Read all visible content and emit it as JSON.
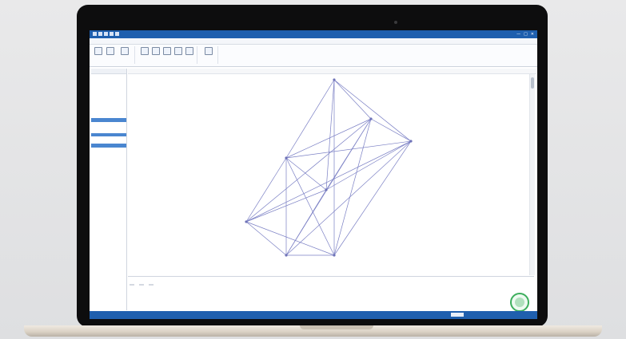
{
  "window": {
    "title": "",
    "controls": [
      "—",
      "□",
      "✕"
    ]
  },
  "menu": {
    "items": [
      "",
      "",
      "",
      "",
      "",
      "",
      "",
      "",
      "",
      ""
    ]
  },
  "ribbon": {
    "groups": [
      {
        "name": "",
        "buttons": [
          "",
          "",
          ""
        ]
      },
      {
        "name": "",
        "buttons": [
          "",
          "",
          "",
          "",
          ""
        ]
      },
      {
        "name": "",
        "buttons": [
          ""
        ]
      }
    ]
  },
  "left_panel": {
    "header": "",
    "items": [
      {
        "label": "",
        "selected": false
      },
      {
        "label": "",
        "selected": false
      },
      {
        "label": "",
        "selected": false
      },
      {
        "label": "",
        "selected": false
      },
      {
        "label": "",
        "selected": false
      },
      {
        "label": "",
        "selected": false
      },
      {
        "label": "",
        "selected": false
      },
      {
        "label": "",
        "selected": false
      },
      {
        "label": "",
        "selected": false
      },
      {
        "label": "",
        "selected": false
      },
      {
        "label": "",
        "selected": false
      },
      {
        "label": "",
        "selected": false
      },
      {
        "label": "",
        "selected": true
      },
      {
        "label": "",
        "selected": false
      },
      {
        "label": "",
        "selected": false
      },
      {
        "label": "",
        "selected": false
      },
      {
        "label": "",
        "selected": true
      },
      {
        "label": "",
        "selected": false
      },
      {
        "label": "",
        "selected": false
      },
      {
        "label": "",
        "selected": true
      }
    ]
  },
  "canvas_toolbar": {
    "label": ""
  },
  "graph": {
    "edge_color": "#7a7fc4",
    "node_color": "#6f73b8"
  },
  "bottom_panel": {
    "tabs": [
      "",
      "",
      ""
    ],
    "lines": [
      "",
      ""
    ],
    "badge_color": "#3cae5c"
  },
  "statusbar": {
    "left": "",
    "right": ""
  },
  "colors": {
    "accent": "#1f5fae",
    "selection": "#4a86d0"
  }
}
